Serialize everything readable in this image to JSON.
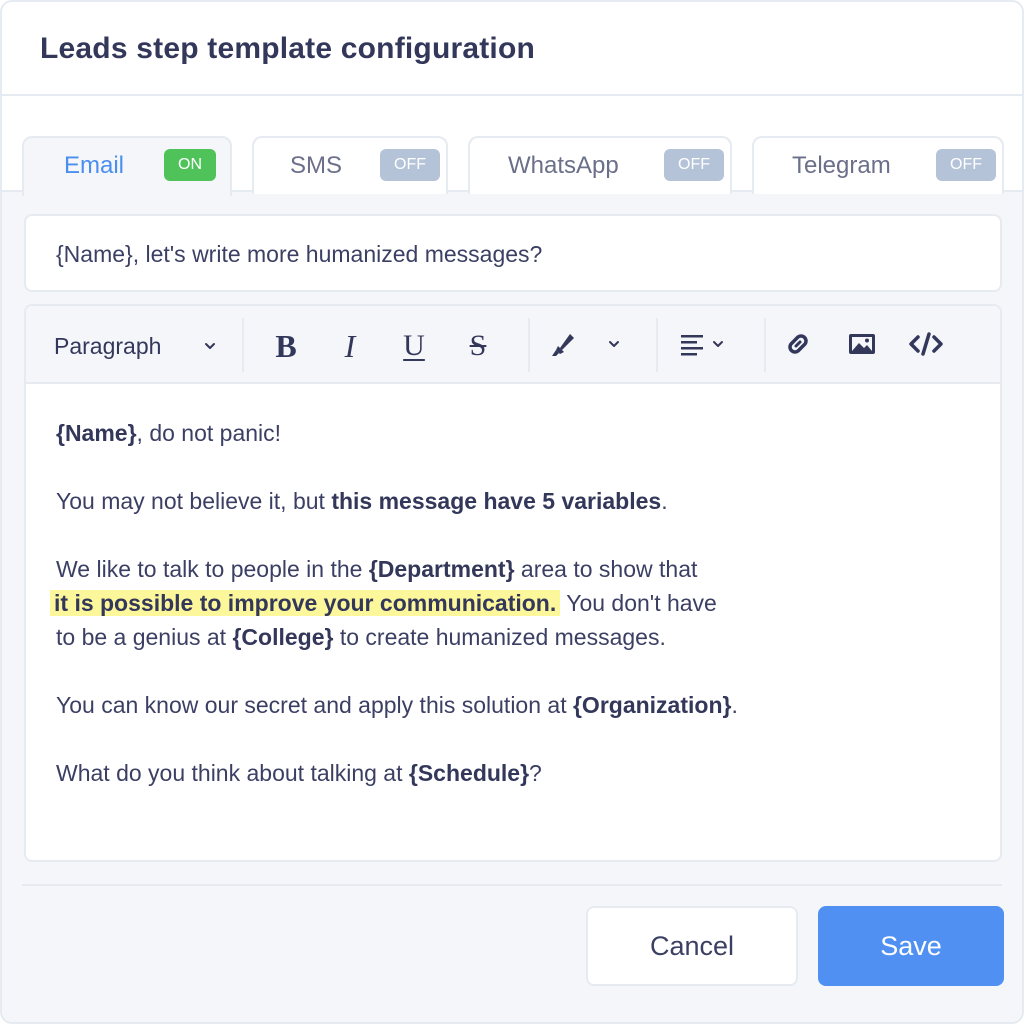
{
  "header": {
    "title": "Leads step template configuration"
  },
  "tabs": [
    {
      "label": "Email",
      "status": "ON",
      "active": true
    },
    {
      "label": "SMS",
      "status": "OFF",
      "active": false
    },
    {
      "label": "WhatsApp",
      "status": "OFF",
      "active": false
    },
    {
      "label": "Telegram",
      "status": "OFF",
      "active": false
    }
  ],
  "subject": {
    "value": "{Name}, let's write more humanized messages?"
  },
  "toolbar": {
    "block_format": "Paragraph",
    "bold": "B",
    "italic": "I",
    "underline": "U",
    "strike": "S",
    "icons": [
      "chevron-down-icon",
      "highlighter-icon",
      "align-left-icon",
      "link-icon",
      "image-icon",
      "code-icon"
    ]
  },
  "body": {
    "p1": {
      "var": "{Name}",
      "rest": ", do not panic!"
    },
    "p2": {
      "pre": "You may not believe it, but ",
      "bold": "this message have 5 variables",
      "post": "."
    },
    "p3": {
      "pre": "We like to talk to people in the ",
      "var1": "{Department}",
      "mid": " area to show that",
      "highlight": "it is possible to improve your communication.",
      "mid2": " You don't have",
      "pre2": "to be a genius at ",
      "var2": "{College}",
      "post": " to create humanized messages."
    },
    "p4": {
      "pre": "You can know our secret and apply this solution at ",
      "var": "{Organization}",
      "post": "."
    },
    "p5": {
      "pre": "What do you think about talking at ",
      "var": "{Schedule}",
      "post": "?"
    }
  },
  "actions": {
    "cancel": "Cancel",
    "save": "Save"
  },
  "colors": {
    "accent": "#5090f2",
    "on": "#4fc35a",
    "off": "#b4c3d8",
    "highlight": "#fbf79a"
  }
}
